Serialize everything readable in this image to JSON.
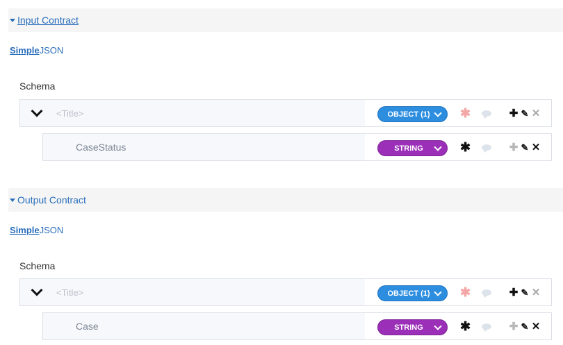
{
  "input": {
    "header": "Input Contract",
    "mode_simple": "Simple",
    "mode_json": "JSON",
    "schema_label": "Schema",
    "root": {
      "title_placeholder": "<Title>",
      "type": "OBJECT (1)"
    },
    "prop": {
      "name": "CaseStatus",
      "type": "STRING"
    }
  },
  "output": {
    "header": "Output Contract",
    "mode_simple": "Simple",
    "mode_json": "JSON",
    "schema_label": "Schema",
    "root": {
      "title_placeholder": "<Title>",
      "type": "OBJECT (1)"
    },
    "prop": {
      "name": "Case",
      "type": "STRING"
    }
  },
  "icons": {
    "caret": "caret-down-icon",
    "chevron": "chevron-down-icon",
    "required": "asterisk-icon",
    "comment": "comment-icon",
    "add": "plus-icon",
    "edit": "pencil-icon",
    "delete": "close-icon"
  },
  "colors": {
    "link": "#2a6ebb",
    "object_pill": "#2d8ee0",
    "string_pill": "#9b2fb8",
    "required_light": "#f3a6a6"
  }
}
